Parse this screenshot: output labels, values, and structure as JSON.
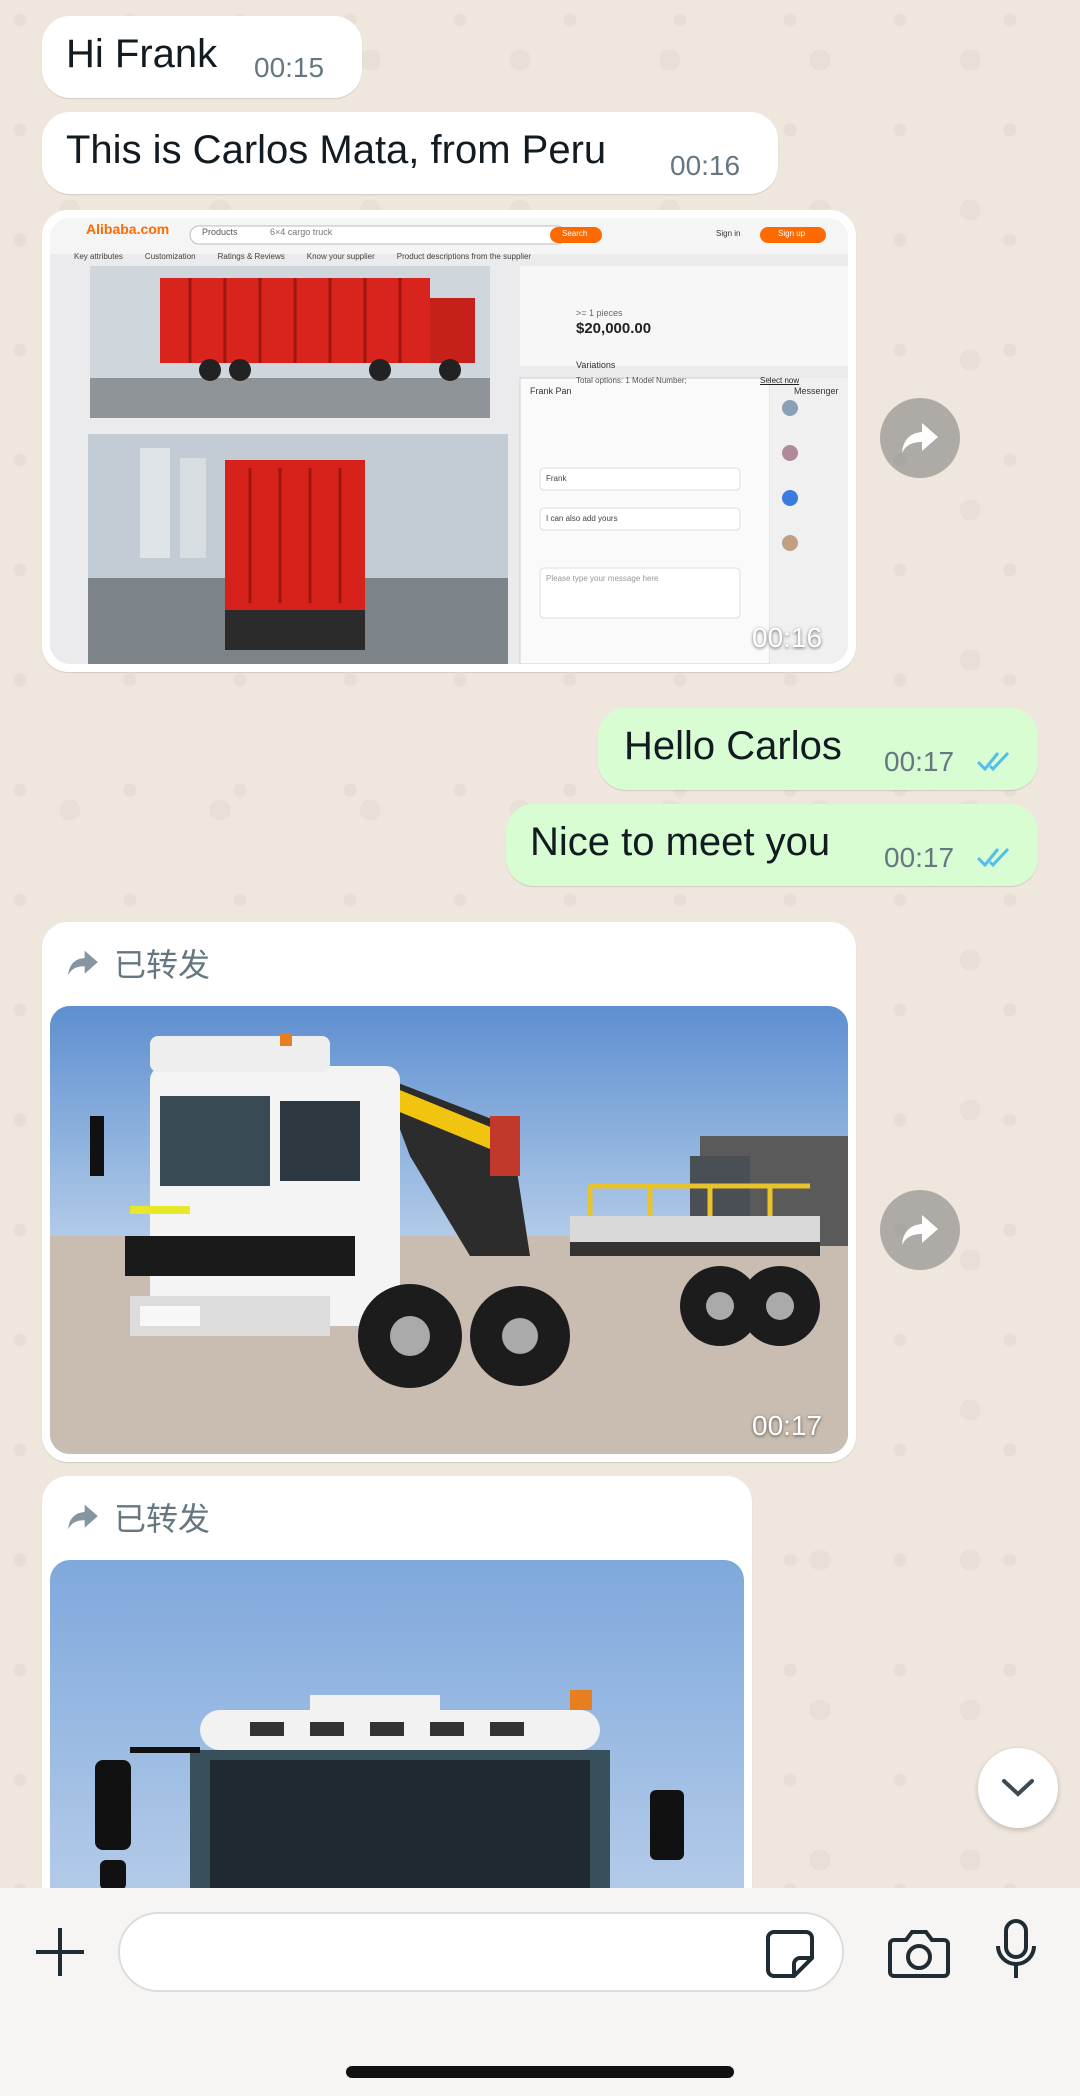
{
  "messages": {
    "m1": {
      "text": "Hi Frank",
      "time": "00:15"
    },
    "m2": {
      "text": "This is Carlos Mata, from Peru",
      "time": "00:16"
    },
    "m3": {
      "time": "00:16",
      "screenshot": {
        "logo": "Alibaba.com",
        "search_category": "Products",
        "search_query": "6×4 cargo truck",
        "search_button": "Search",
        "signin": "Sign in",
        "signup": "Sign up",
        "tabs": [
          "Key attributes",
          "Customization",
          "Ratings & Reviews",
          "Know your supplier",
          "Product descriptions from the supplier"
        ],
        "pieces": ">= 1 pieces",
        "price": "$20,000.00",
        "variations": "Variations",
        "total_options": "Total options: 1 Model Number;",
        "select_now": "Select now",
        "chat_title": "Frank Pan",
        "messenger": "Messenger",
        "chat_line1": "Frank",
        "chat_line2": "I can also add yours",
        "chat_input": "Please type your message here"
      }
    },
    "m4": {
      "text": "Hello Carlos",
      "time": "00:17"
    },
    "m5": {
      "text": "Nice to meet you",
      "time": "00:17"
    },
    "m6": {
      "forwarded_label": "已转发",
      "time": "00:17"
    },
    "m7": {
      "forwarded_label": "已转发"
    }
  },
  "colors": {
    "incoming": "#ffffff",
    "outgoing": "#d9fdd3",
    "read_ticks": "#53bdeb",
    "wallpaper": "#efe7de"
  },
  "icons": [
    "share-forward-icon",
    "double-check-icon",
    "plus-icon",
    "sticker-icon",
    "camera-icon",
    "microphone-icon",
    "chevron-down-icon"
  ]
}
